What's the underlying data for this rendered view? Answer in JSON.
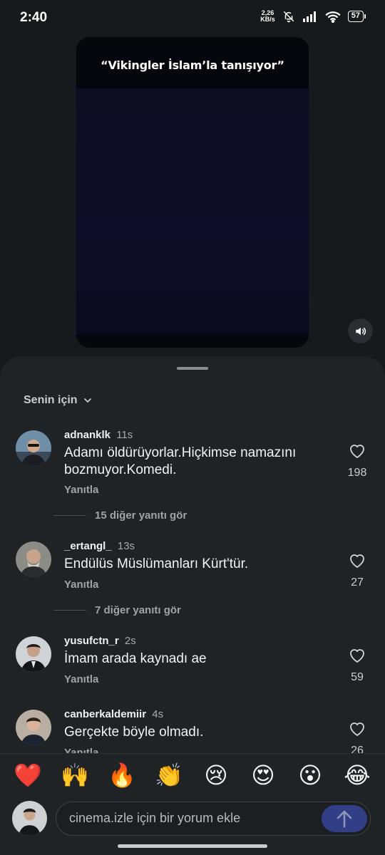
{
  "status_bar": {
    "time": "2:40",
    "net_speed_value": "2,26",
    "net_speed_unit": "KB/s",
    "battery": "57"
  },
  "video": {
    "caption": "“Vikingler İslam’la tanışıyor”",
    "sound_icon": "volume-icon"
  },
  "comments_sheet": {
    "filter_label": "Senin için",
    "reply_label": "Yanıtla",
    "comments": [
      {
        "user": "adnanklk",
        "time": "11s",
        "text": "Adamı öldürüyorlar.Hiçkimse namazını bozmuyor.Komedi.",
        "likes": "198",
        "more_replies": "15 diğer yanıtı gör"
      },
      {
        "user": "_ertangl_",
        "time": "13s",
        "text": "Endülüs Müslümanları Kürt'tür.",
        "likes": "27",
        "more_replies": "7 diğer yanıtı gör"
      },
      {
        "user": "yusufctn_r",
        "time": "2s",
        "text": "İmam arada kaynadı ae",
        "likes": "59"
      },
      {
        "user": "canberkaldemiir",
        "time": "4s",
        "text": "Gerçekte böyle olmadı.",
        "likes": "26"
      }
    ]
  },
  "reactions": [
    "❤️",
    "🙌",
    "🔥",
    "👏",
    "😢",
    "😍",
    "😮",
    "😂"
  ],
  "composer": {
    "placeholder": "cinema.izle için bir yorum ekle"
  },
  "colors": {
    "background": "#17191c",
    "sheet": "#202326",
    "send_button": "#323e86"
  }
}
